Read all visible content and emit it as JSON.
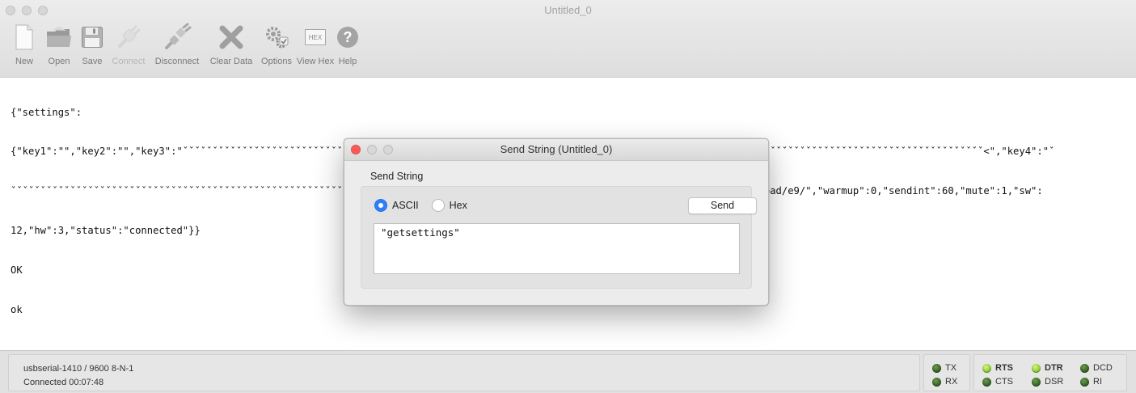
{
  "window": {
    "title": "Untitled_0"
  },
  "toolbar": {
    "items": [
      {
        "label": "New",
        "icon": "new-file-icon",
        "enabled": true
      },
      {
        "label": "Open",
        "icon": "open-folder-icon",
        "enabled": true
      },
      {
        "label": "Save",
        "icon": "floppy-disk-icon",
        "enabled": true
      },
      {
        "label": "Connect",
        "icon": "connect-plug-icon",
        "enabled": false
      },
      {
        "label": "Disconnect",
        "icon": "disconnect-plug-icon",
        "enabled": true
      },
      {
        "label": "Clear Data",
        "icon": "clear-x-icon",
        "enabled": true
      },
      {
        "label": "Options",
        "icon": "options-gears-icon",
        "enabled": true
      },
      {
        "label": "View Hex",
        "icon": "hex-icon",
        "enabled": true
      },
      {
        "label": "Help",
        "icon": "help-question-icon",
        "enabled": true
      }
    ],
    "hex_badge": "HEX"
  },
  "console": {
    "lines": [
      "{\"settings\":",
      "{\"key1\":\"\",\"key2\":\"\",\"key3\":\"ˇˇˇˇˇˇˇˇˇˇˇˇˇˇˇˇˇˇˇˇˇˇˇˇˇˇˇˇˇˇˇˇˇˇˇˇˇˇˇˇˇˇˇˇˇˇˇˇˇˇˇˇˇˇˇˇˇˇˇˇˇˇˇˇˇˇˇˇˇˇˇˇˇˇˇˇˇˇˇˇˇˇˇˇˇˇˇˇˇˇˇˇˇˇˇˇˇˇˇˇˇˇˇˇˇˇˇˇˇˇˇˇˇˇˇˇˇˇˇˇˇˇˇˇˇˇˇˇˇˇˇˇˇˇˇ<\",\"key4\":\"ˇ",
      "ˇˇˇˇˇˇˇˇˇˇˇˇˇˇˇˇˇˇˇˇˇˇˇˇˇˇˇˇˇˇˇˇˇˇˇˇˇˇˇˇˇˇˇˇˇˇˇˇˇˇˇˇˇˇˇˇˇˇˇˇˇˇˇˇˇˇˇˇˇˇˇ<\",\"server\":\"data.uradmonitor.com\",\"script\":\"/api/v1/upload/e9/\",\"warmup\":0,\"sendint\":60,\"mute\":1,\"sw\":",
      "12,\"hw\":3,\"status\":\"connected\"}}",
      "OK",
      "ok"
    ]
  },
  "dialog": {
    "title": "Send String (Untitled_0)",
    "group_label": "Send String",
    "mode_ascii_label": "ASCII",
    "mode_hex_label": "Hex",
    "selected_mode": "ASCII",
    "send_label": "Send",
    "input_value": "\"getsettings\""
  },
  "status": {
    "port": "usbserial-1410 / 9600 8-N-1",
    "connection": "Connected 00:07:48",
    "leds": {
      "tx": {
        "label": "TX",
        "on": false
      },
      "rx": {
        "label": "RX",
        "on": false
      },
      "rts": {
        "label": "RTS",
        "on": true
      },
      "cts": {
        "label": "CTS",
        "on": false
      },
      "dtr": {
        "label": "DTR",
        "on": true
      },
      "dsr": {
        "label": "DSR",
        "on": false
      },
      "dcd": {
        "label": "DCD",
        "on": false
      },
      "ri": {
        "label": "RI",
        "on": false
      }
    }
  },
  "colors": {
    "accent": "#2f7ff6",
    "led_off": "#3f6e29",
    "led_on": "#a8e04a",
    "close_red": "#fc5b57",
    "inactive_dot": "#d6d6d6"
  }
}
